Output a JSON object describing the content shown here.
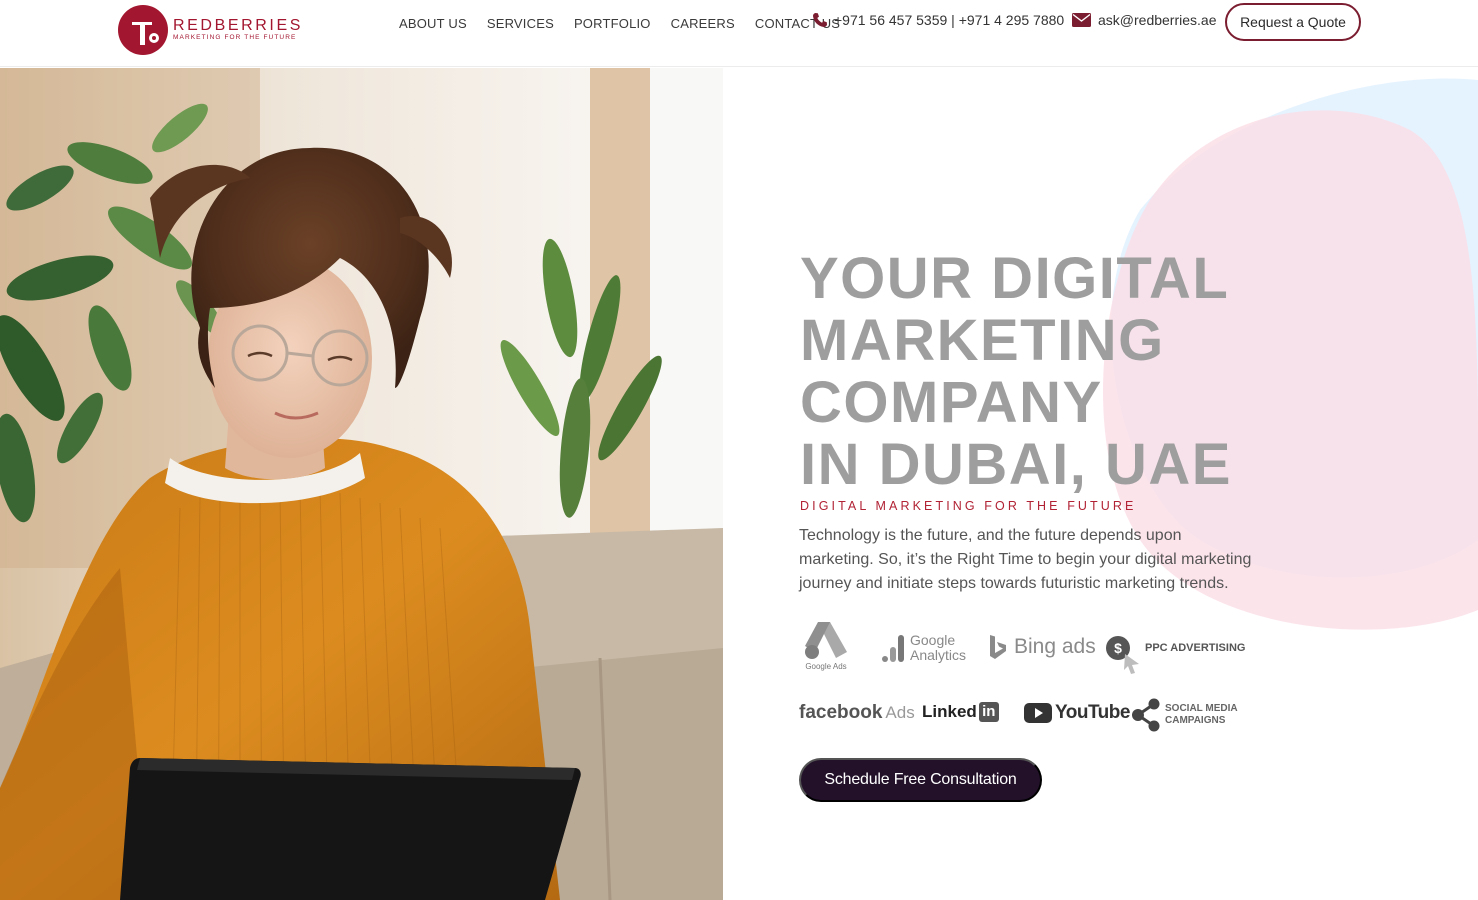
{
  "brand": {
    "name": "REDBERRIES",
    "tagline": "MARKETING FOR THE FUTURE",
    "color": "#a3162f"
  },
  "nav": {
    "items": [
      {
        "label": "ABOUT US"
      },
      {
        "label": "SERVICES"
      },
      {
        "label": "PORTFOLIO"
      },
      {
        "label": "CAREERS"
      },
      {
        "label": "CONTACT US"
      }
    ]
  },
  "contact": {
    "phone_icon": "phone-icon",
    "phones": "+971 56 457 5359 | +971 4 295 7880",
    "email_icon": "envelope-icon",
    "email": "ask@redberries.ae"
  },
  "header": {
    "quote_button": "Request a Quote"
  },
  "hero": {
    "headline_lines": [
      "YOUR DIGITAL",
      "MARKETING",
      "COMPANY",
      "IN DUBAI, UAE"
    ],
    "tagline": "DIGITAL MARKETING FOR THE FUTURE",
    "description": "Technology is the future, and the future depends upon marketing. So, it’s the Right Time to begin your digital marketing journey and initiate steps towards futuristic marketing trends.",
    "cta": "Schedule Free Consultation"
  },
  "partners": {
    "google_ads": "Google Ads",
    "google_analytics_1": "Google",
    "google_analytics_2": "Analytics",
    "bing": "Bing ads",
    "ppc": "PPC ADVERTISING",
    "facebook": "facebook",
    "facebook_ads": "Ads",
    "linkedin": "Linked",
    "linkedin_in": "in",
    "youtube": "YouTube",
    "social_1": "SOCIAL MEDIA",
    "social_2": "CAMPAIGNS"
  },
  "colors": {
    "accent": "#a3162f",
    "cta_bg": "#23112a",
    "quote_border": "#7b1d30",
    "headline": "#9e9e9e"
  }
}
